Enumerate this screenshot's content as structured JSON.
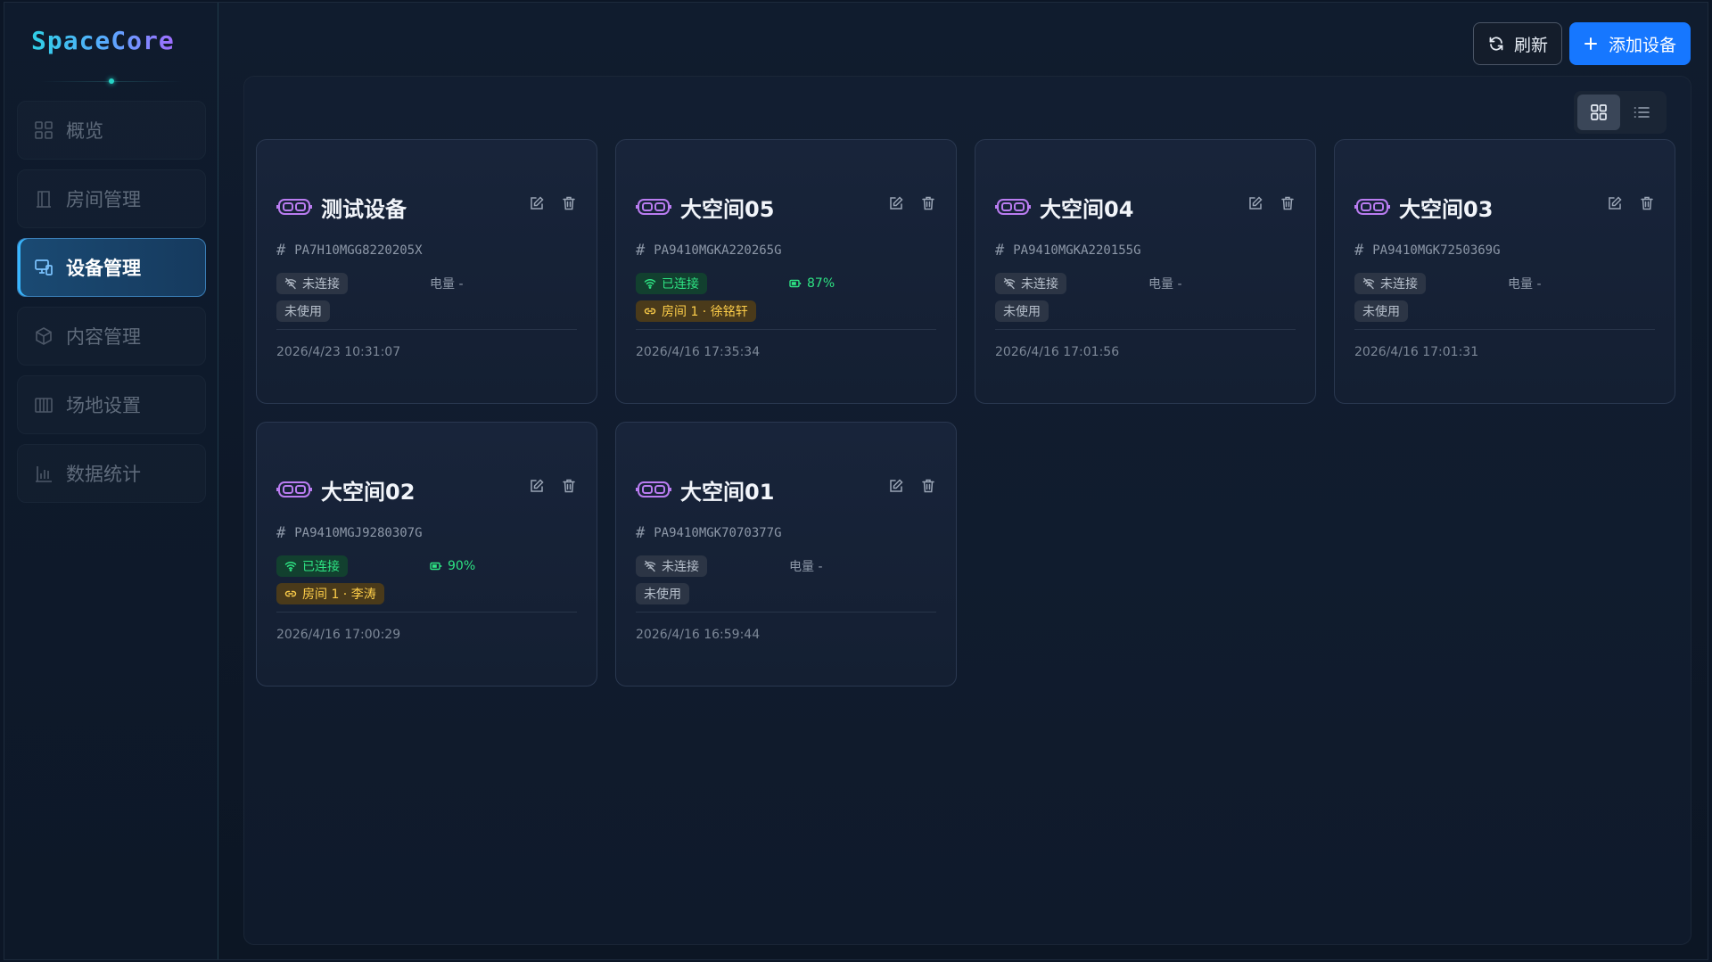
{
  "app": {
    "logo": "SpaceCore"
  },
  "sidebar": {
    "items": [
      {
        "label": "概览",
        "icon": "grid-icon",
        "active": false
      },
      {
        "label": "房间管理",
        "icon": "door-icon",
        "active": false
      },
      {
        "label": "设备管理",
        "icon": "devices-icon",
        "active": true
      },
      {
        "label": "内容管理",
        "icon": "cube-icon",
        "active": false
      },
      {
        "label": "场地设置",
        "icon": "venue-icon",
        "active": false
      },
      {
        "label": "数据统计",
        "icon": "bar-chart-icon",
        "active": false
      }
    ]
  },
  "toolbar": {
    "refresh_label": "刷新",
    "add_label": "添加设备"
  },
  "view": {
    "mode": "grid"
  },
  "colors": {
    "accent": "#1677ff",
    "connected": "#2ee383",
    "room": "#ffcf4a",
    "vr_icon": "#b97cf0"
  },
  "devices": [
    {
      "name": "测试设备",
      "serial": "PA7H10MGG8220205X",
      "status": "未连接",
      "connected": false,
      "battery": "电量 -",
      "usage": "未使用",
      "in_room": false,
      "time": "2026/4/23 10:31:07"
    },
    {
      "name": "大空间05",
      "serial": "PA9410MGKA220265G",
      "status": "已连接",
      "connected": true,
      "battery": "87%",
      "usage": "房间 1 · 徐铭轩",
      "in_room": true,
      "time": "2026/4/16 17:35:34"
    },
    {
      "name": "大空间04",
      "serial": "PA9410MGKA220155G",
      "status": "未连接",
      "connected": false,
      "battery": "电量 -",
      "usage": "未使用",
      "in_room": false,
      "time": "2026/4/16 17:01:56"
    },
    {
      "name": "大空间03",
      "serial": "PA9410MGK7250369G",
      "status": "未连接",
      "connected": false,
      "battery": "电量 -",
      "usage": "未使用",
      "in_room": false,
      "time": "2026/4/16 17:01:31"
    },
    {
      "name": "大空间02",
      "serial": "PA9410MGJ9280307G",
      "status": "已连接",
      "connected": true,
      "battery": "90%",
      "usage": "房间 1 · 李涛",
      "in_room": true,
      "time": "2026/4/16 17:00:29"
    },
    {
      "name": "大空间01",
      "serial": "PA9410MGK7070377G",
      "status": "未连接",
      "connected": false,
      "battery": "电量 -",
      "usage": "未使用",
      "in_room": false,
      "time": "2026/4/16 16:59:44"
    }
  ]
}
